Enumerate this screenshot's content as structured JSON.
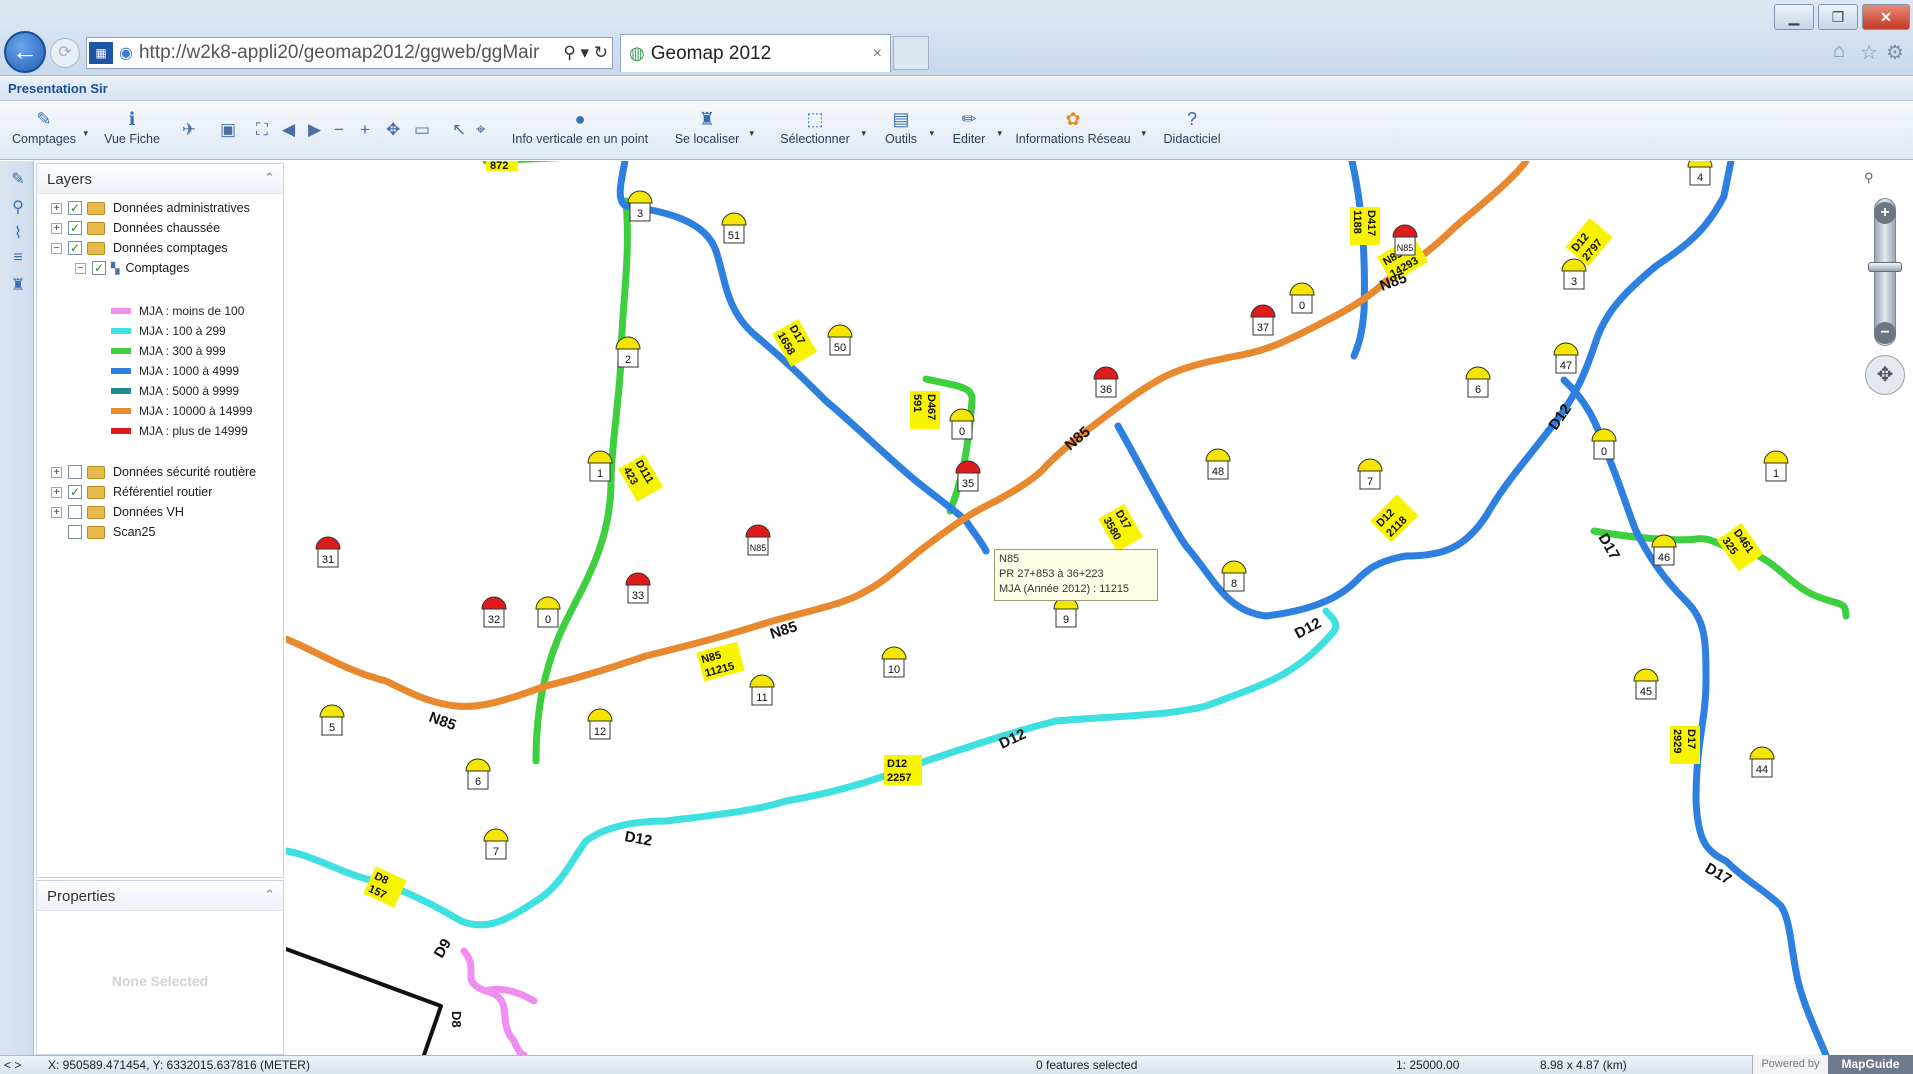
{
  "browser": {
    "url": "http://w2k8-appli20/geomap2012/ggweb/ggMair",
    "tab_title": "Geomap 2012",
    "tab_close": "×",
    "back": "←",
    "forward": "⟳",
    "search_ctl": "⚲ ▾ ↻"
  },
  "app": {
    "title": "Presentation Sir"
  },
  "toolbar": {
    "comptages": "Comptages",
    "vue_fiche": "Vue Fiche",
    "info_verticale": "Info verticale en un point",
    "se_localiser": "Se localiser",
    "selectionner": "Sélectionner",
    "outils": "Outils",
    "editer": "Editer",
    "informations_reseau": "Informations Réseau",
    "didacticiel": "Didacticiel"
  },
  "layers_panel": {
    "title": "Layers",
    "groups": [
      {
        "label": "Données administratives",
        "checked": true
      },
      {
        "label": "Données chaussée",
        "checked": true
      },
      {
        "label": "Données comptages",
        "checked": true
      },
      {
        "label": "Comptages",
        "checked": true
      },
      {
        "label": "Données sécurité routière",
        "checked": false
      },
      {
        "label": "Référentiel routier",
        "checked": true
      },
      {
        "label": "Données VH",
        "checked": false
      },
      {
        "label": "Scan25",
        "checked": false
      }
    ],
    "legend": [
      {
        "label": "MJA : moins de 100",
        "color": "#f08ef0"
      },
      {
        "label": "MJA : 100 à 299",
        "color": "#3fe0e0"
      },
      {
        "label": "MJA : 300 à 999",
        "color": "#3dcf3d"
      },
      {
        "label": "MJA : 1000 à 4999",
        "color": "#2d7fe0"
      },
      {
        "label": "MJA : 5000 à 9999",
        "color": "#1f8b8b"
      },
      {
        "label": "MJA : 10000 à 14999",
        "color": "#e8892f"
      },
      {
        "label": "MJA : plus de 14999",
        "color": "#e01b1b"
      }
    ]
  },
  "properties_panel": {
    "title": "Properties",
    "empty": "None Selected"
  },
  "map": {
    "tooltip": {
      "line1": "N85",
      "line2": "PR 27+853 à 36+223",
      "line3": "MJA (Année 2012) : 11215"
    },
    "markers": [
      "3",
      "51",
      "2",
      "1",
      "0",
      "33",
      "32",
      "31",
      "N85",
      "35",
      "0",
      "50",
      "36",
      "37",
      "0",
      "N85",
      "4",
      "3",
      "47",
      "6",
      "7",
      "48",
      "0",
      "1",
      "8",
      "9",
      "10",
      "11",
      "12",
      "5",
      "6",
      "7",
      "46",
      "45",
      "44"
    ],
    "road_labels": [
      "872",
      "D417 1188",
      "N85 14293",
      "D17 1658",
      "D467 591",
      "N85",
      "D111 423",
      "N85 11215",
      "N85",
      "D17 3580",
      "D12 2118",
      "D12 2797",
      "D12",
      "D461 325",
      "D17",
      "D12",
      "D12",
      "D12 2257",
      "D12",
      "D8 157",
      "D8",
      "D9",
      "D17 2929",
      "D17"
    ]
  },
  "status": {
    "coords": "X: 950589.471454, Y: 6332015.637816 (METER)",
    "features": "0 features selected",
    "scale": "1: 25000.00",
    "extent": "8.98 x 4.87 (km)",
    "powered": "Powered by",
    "brand": "MapGuide"
  }
}
